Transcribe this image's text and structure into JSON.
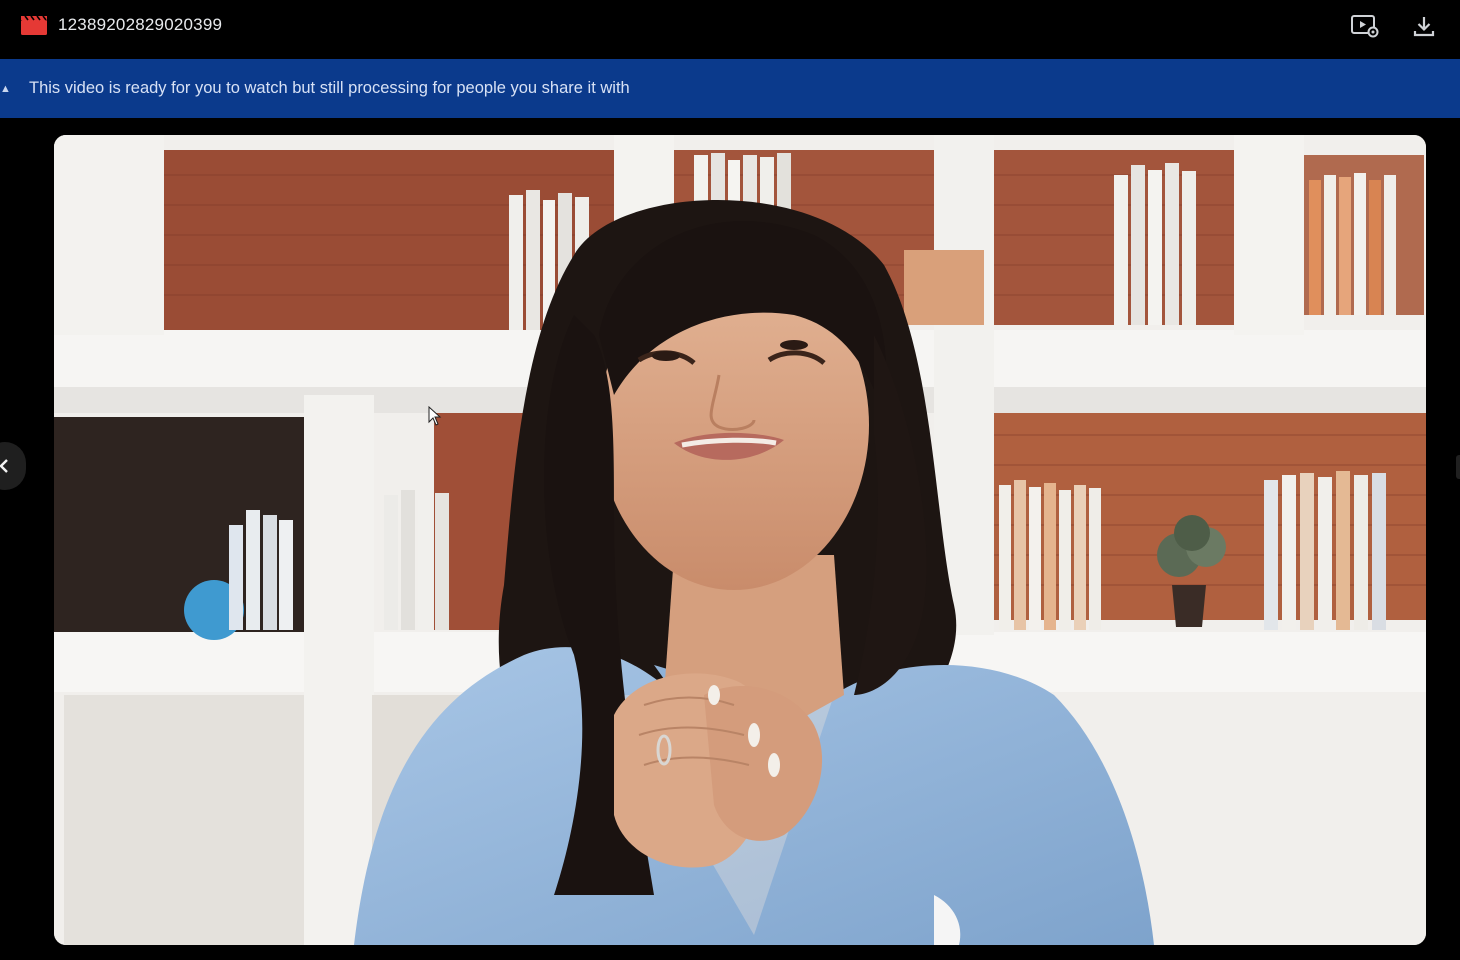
{
  "file": {
    "title": "12389202829020399",
    "icon": "video-clapperboard-icon",
    "icon_color": "#e53935"
  },
  "toolbar": {
    "player_settings_icon": "video-settings-icon",
    "download_icon": "download-icon"
  },
  "banner": {
    "message": "This video is ready for you to watch but still processing for people you share it with",
    "background": "#0b3a8c",
    "collapse_icon": "caret-up-icon"
  },
  "viewer": {
    "prev_icon": "chevron-left-icon"
  }
}
